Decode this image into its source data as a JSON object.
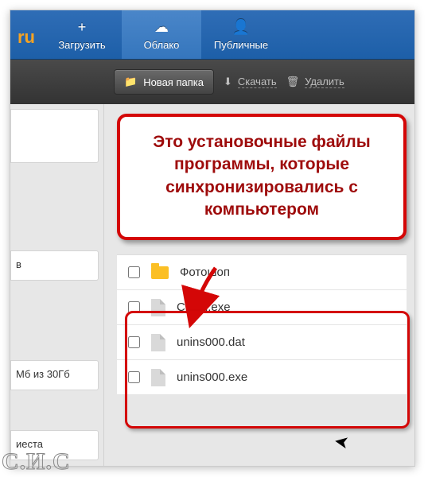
{
  "logo_fragment": "ru",
  "nav": {
    "upload": "Загрузить",
    "cloud": "Облако",
    "public": "Публичные"
  },
  "toolbar": {
    "new_folder": "Новая папка",
    "download": "Скачать",
    "delete": "Удалить"
  },
  "sidebar": {
    "frag1": "в",
    "frag2": "Мб из 30Гб",
    "frag3": "иеста"
  },
  "callout": "Это установочные файлы программы, которые синхронизировались с компьютером",
  "files": {
    "folder": "Фотошоп",
    "f1": "Cloud.exe",
    "f2": "unins000.dat",
    "f3": "unins000.exe"
  },
  "watermark": "С.И.С"
}
